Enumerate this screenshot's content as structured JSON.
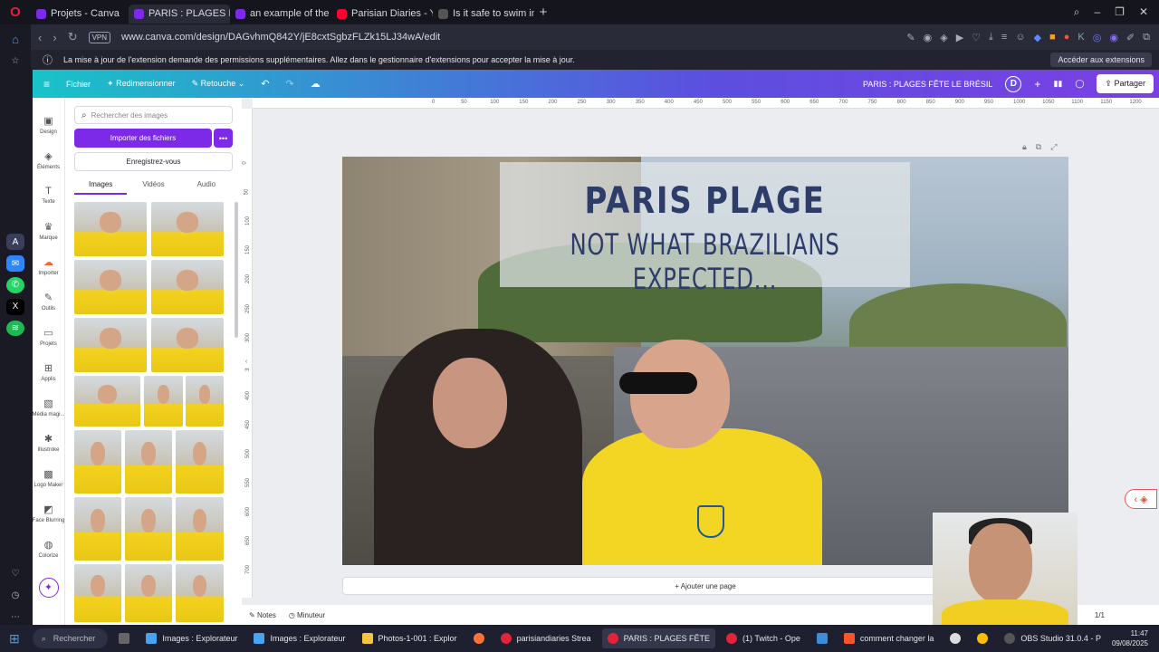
{
  "browser": {
    "tabs": [
      {
        "title": "Projets - Canva",
        "color": "#7d2ae8",
        "active": false
      },
      {
        "title": "PARIS : PLAGES FÊTE LE BR",
        "color": "#7d2ae8",
        "active": true
      },
      {
        "title": "an example of the way co",
        "color": "#7d2ae8",
        "active": false
      },
      {
        "title": "Parisian Diaries - YouTube",
        "color": "#ff0033",
        "active": false
      },
      {
        "title": "Is it safe to swim in the Se",
        "color": "#444",
        "active": false
      }
    ],
    "vpn": "VPN",
    "url": "www.canva.com/design/DAGvhmQ842Y/jE8cxtSgbzFLZk15LJ34wA/edit",
    "infobar_text": "La mise à jour de l'extension demande des permissions supplémentaires. Allez dans le gestionnaire d'extensions pour accepter la mise à jour.",
    "infobar_button": "Accéder aux extensions"
  },
  "canva": {
    "menu_file": "Fichier",
    "menu_resize": "Redimensionner",
    "menu_edit": "Retouche",
    "design_title": "PARIS : PLAGES FÊTE LE BRÉSIL",
    "avatar_letter": "D",
    "share": "Partager",
    "leftnav": [
      "Design",
      "Éléments",
      "Texte",
      "Marque",
      "Importer",
      "Outils",
      "Projets",
      "Applis",
      "Média magi...",
      "Illustroke",
      "Logo Maker",
      "Face Blurring",
      "Colorize"
    ],
    "search_placeholder": "Rechercher des images",
    "import_button": "Importer des fichiers",
    "register_button": "Enregistrez-vous",
    "panel_tabs": [
      "Images",
      "Vidéos",
      "Audio"
    ],
    "ruler_top": [
      "0",
      "50",
      "100",
      "150",
      "200",
      "250",
      "300",
      "350",
      "400",
      "450",
      "500",
      "550",
      "600",
      "650",
      "700",
      "750",
      "800",
      "850",
      "900",
      "950",
      "1000",
      "1050",
      "1100",
      "1150",
      "1200",
      "1250"
    ],
    "ruler_left": [
      "0",
      "50",
      "100",
      "150",
      "200",
      "250",
      "300",
      "350",
      "400",
      "450",
      "500",
      "550",
      "600",
      "650",
      "700"
    ],
    "design_line1": "PARIS PLAGE",
    "design_line2": "NOT WHAT BRAZILIANS EXPECTED...",
    "add_page": "+ Ajouter une page",
    "notes": "Notes",
    "timer": "Minuteur",
    "page_count": "1/1"
  },
  "taskbar": {
    "search": "Rechercher",
    "items": [
      {
        "label": "Images : Explorateur",
        "color": "#4aa3f0"
      },
      {
        "label": "Images : Explorateur",
        "color": "#4aa3f0"
      },
      {
        "label": "Photos-1-001 : Explor",
        "color": "#f5c542"
      },
      {
        "label": "parisiandiaries Strea",
        "color": "#e2233b"
      },
      {
        "label": "PARIS : PLAGES FÊTE",
        "color": "#e2233b"
      },
      {
        "label": "(1) Twitch - Ope",
        "color": "#e2233b"
      },
      {
        "label": "comment changer la",
        "color": "#fb542b"
      },
      {
        "label": "OBS Studio 31.0.4 - P",
        "color": "#555"
      }
    ],
    "time": "11:47",
    "date": "09/08/2025"
  }
}
